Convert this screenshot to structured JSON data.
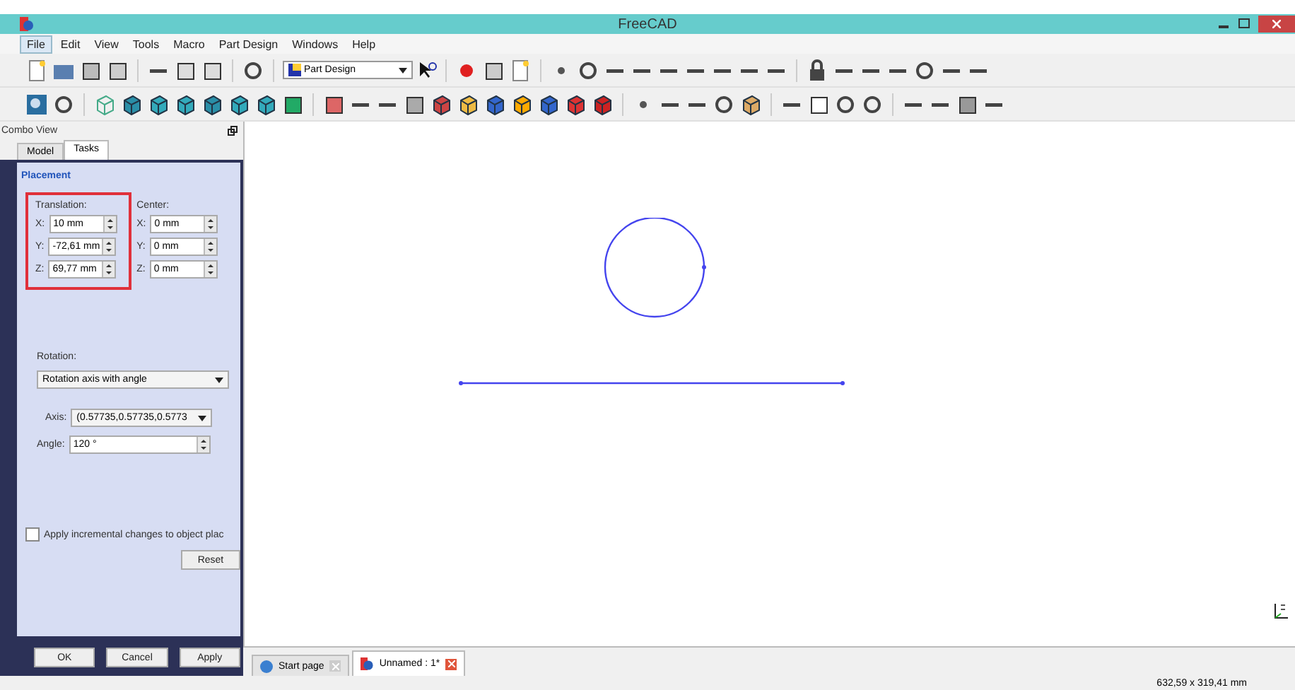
{
  "window": {
    "title": "FreeCAD"
  },
  "menu": [
    {
      "label": "File",
      "selected": true
    },
    {
      "label": "Edit",
      "selected": false
    },
    {
      "label": "View",
      "selected": false
    },
    {
      "label": "Tools",
      "selected": false
    },
    {
      "label": "Macro",
      "selected": false
    },
    {
      "label": "Part Design",
      "selected": false
    },
    {
      "label": "Windows",
      "selected": false
    },
    {
      "label": "Help",
      "selected": false
    }
  ],
  "workbench": {
    "value": "Part Design"
  },
  "combo_view": {
    "title": "Combo View",
    "tabs": [
      {
        "label": "Model",
        "selected": false
      },
      {
        "label": "Tasks",
        "selected": true
      }
    ],
    "placement": {
      "title": "Placement",
      "translation": {
        "label": "Translation:",
        "fields": [
          {
            "axis": "X:",
            "value": "10 mm"
          },
          {
            "axis": "Y:",
            "value": "-72,61 mm"
          },
          {
            "axis": "Z:",
            "value": "69,77 mm"
          }
        ]
      },
      "center": {
        "label": "Center:",
        "fields": [
          {
            "axis": "X:",
            "value": "0 mm"
          },
          {
            "axis": "Y:",
            "value": "0 mm"
          },
          {
            "axis": "Z:",
            "value": "0 mm"
          }
        ]
      },
      "rotation": {
        "label": "Rotation:",
        "mode": "Rotation axis with angle",
        "axis_label": "Axis:",
        "axis_value": "(0.57735,0.57735,0.5773",
        "angle_label": "Angle:",
        "angle_value": "120 °"
      },
      "incremental": {
        "label": "Apply incremental changes to object plac",
        "checked": false
      },
      "reset": "Reset"
    },
    "buttons": [
      "OK",
      "Cancel",
      "Apply"
    ]
  },
  "documents": [
    {
      "label": "Start page",
      "selected": false
    },
    {
      "label": "Unnamed : 1*",
      "selected": true
    }
  ],
  "status_bar": {
    "dimensions": "632,59 x 319,41 mm"
  }
}
